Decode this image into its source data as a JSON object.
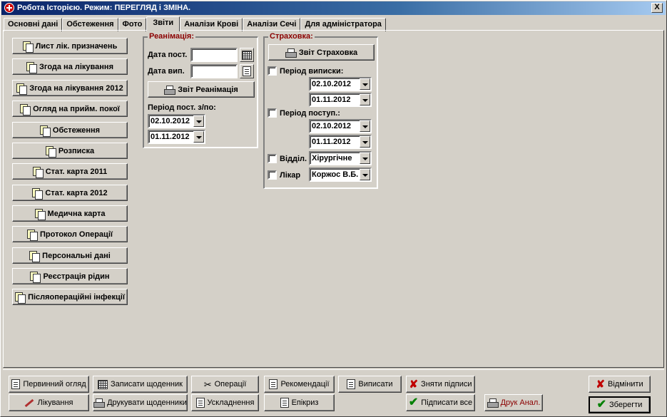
{
  "window": {
    "title": "Робота Історією. Режим: ПЕРЕГЛЯД і ЗМІНА.",
    "close_label": "X"
  },
  "tabs": [
    {
      "label": "Основні дані"
    },
    {
      "label": "Обстеження"
    },
    {
      "label": "Фото"
    },
    {
      "label": "Звіти",
      "active": true
    },
    {
      "label": "Аналізи Крові"
    },
    {
      "label": "Аналізи Сечі"
    },
    {
      "label": "Для адміністратора"
    }
  ],
  "report_buttons": [
    {
      "label": "Лист лік. призначень",
      "icon": "docs-icon"
    },
    {
      "label": "Згода на лікування",
      "icon": "docs-icon"
    },
    {
      "label": "Згода на лікування 2012",
      "icon": "docs-icon"
    },
    {
      "label": "Огляд на прийм. покої",
      "icon": "docs-icon"
    },
    {
      "label": "Обстеження",
      "icon": "docs-icon"
    },
    {
      "label": "Розписка",
      "icon": "docs-icon"
    },
    {
      "label": "Стат. карта 2011",
      "icon": "docs-icon"
    },
    {
      "label": "Стат. карта 2012",
      "icon": "docs-icon"
    },
    {
      "label": "Медична карта",
      "icon": "docs-icon"
    },
    {
      "label": "Протокол Операції",
      "icon": "docs-icon"
    },
    {
      "label": "Персональні дані",
      "icon": "docs-icon"
    },
    {
      "label": "Реєстрація рідин",
      "icon": "docs-icon"
    },
    {
      "label": "Післяопераційні інфекції",
      "icon": "docs-icon"
    }
  ],
  "reanimation": {
    "title": "Реанімація:",
    "date_admit_label": "Дата пост.",
    "date_admit_value": "",
    "date_discharge_label": "Дата вип.",
    "date_discharge_value": "",
    "report_button": "Звіт Реанімація",
    "period_label": "Період  пост. з/по:",
    "period_from": "02.10.2012",
    "period_to": "01.11.2012"
  },
  "insurance": {
    "title": "Страховка:",
    "report_button": "Звіт Страховка",
    "discharge_period_label": "Період виписки:",
    "discharge_from": "02.10.2012",
    "discharge_to": "01.11.2012",
    "admit_period_label": "Період поступ.:",
    "admit_from": "02.10.2012",
    "admit_to": "01.11.2012",
    "department_label": "Відділ.",
    "department_value": "Хірургічне",
    "doctor_label": "Лікар",
    "doctor_value": "Коржос В.Б."
  },
  "bottom": {
    "initial_exam": "Первинний огляд",
    "write_diary": "Записати щоденник",
    "operations": "Операції",
    "recommendations": "Рекомендації",
    "discharges": "Виписати",
    "remove_signatures": "Зняти підписи",
    "cancel": "Відмінити",
    "treatment": "Лікування",
    "print_diaries": "Друкувати щоденники",
    "complications": "Ускладнення",
    "epicrisis": "Епікриз",
    "sign_all": "Підписати все",
    "print_analysis": "Друк Анал.",
    "save": "Зберегти"
  }
}
